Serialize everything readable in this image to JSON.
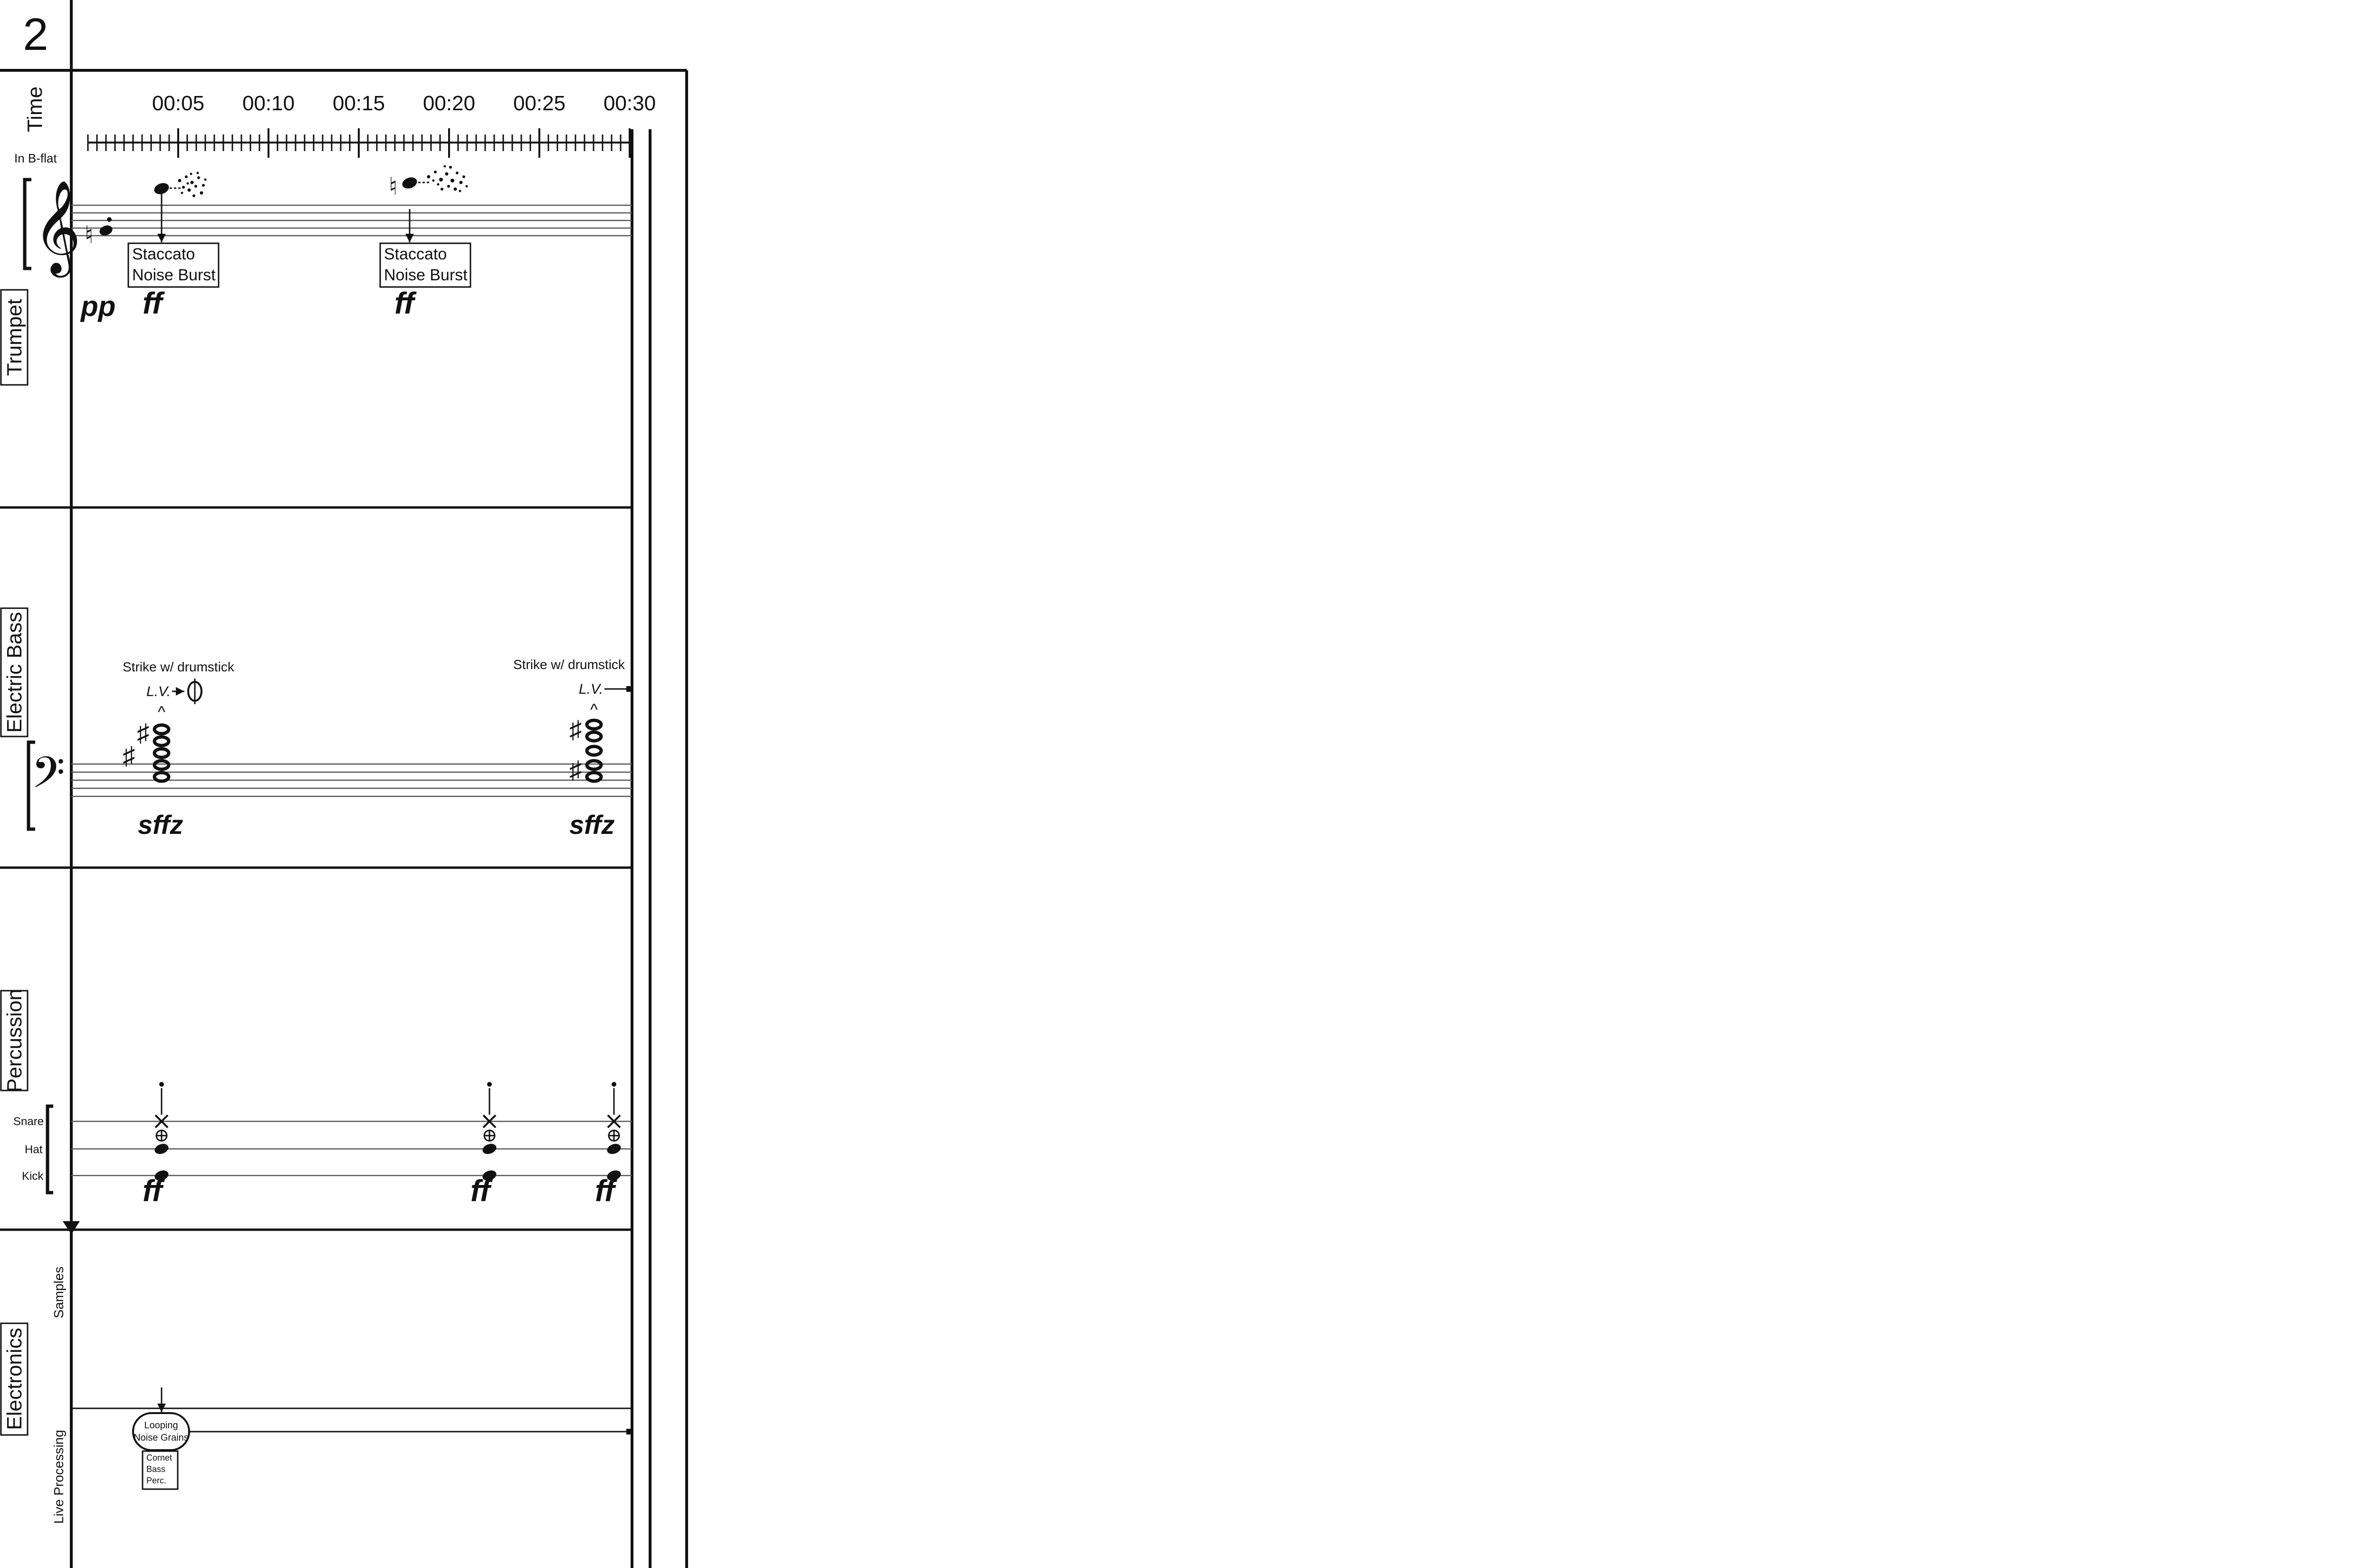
{
  "page_number": "2",
  "labels": {
    "time": "Time",
    "transposition": "In B-flat",
    "trumpet": "Trumpet",
    "electric_bass": "Electric Bass",
    "percussion": "Percussion",
    "electronics": "Electronics",
    "samples": "Samples",
    "live_processing": "Live Processing"
  },
  "timeline": {
    "ticks": [
      "00:05",
      "00:10",
      "00:15",
      "00:20",
      "00:25",
      "00:30"
    ]
  },
  "trumpet": {
    "dynamic_start": "pp",
    "events": [
      {
        "box_line1": "Staccato",
        "box_line2": "Noise Burst",
        "dynamic": "ff"
      },
      {
        "box_line1": "Staccato",
        "box_line2": "Noise Burst",
        "dynamic": "ff"
      }
    ]
  },
  "bass": {
    "events": [
      {
        "instruction": "Strike w/ drumstick",
        "lv": "L.V.",
        "dynamic": "sffz"
      },
      {
        "instruction": "Strike w/ drumstick",
        "lv": "L.V.",
        "dynamic": "sffz"
      }
    ]
  },
  "percussion": {
    "staff_labels": [
      "Snare",
      "Hat",
      "Kick"
    ],
    "dynamics": [
      "ff",
      "ff",
      "ff"
    ]
  },
  "electronics": {
    "bubble_line1": "Looping",
    "bubble_line2": "Noise Grains",
    "sources": [
      "Cornet",
      "Bass",
      "Perc."
    ]
  },
  "colors": {
    "ink": "#111111",
    "staff_line": "#555555",
    "paper": "#ffffff"
  }
}
